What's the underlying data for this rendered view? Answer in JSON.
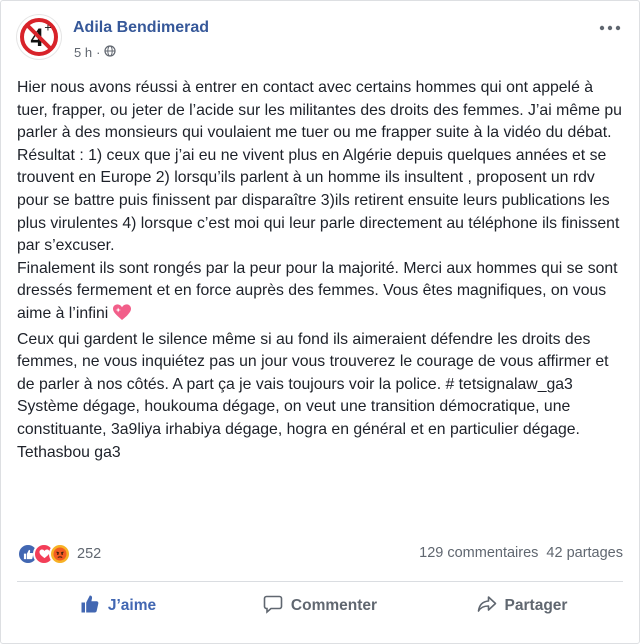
{
  "post": {
    "author": "Adila Bendimerad",
    "timestamp": "5 h",
    "separator": "·",
    "privacy_icon": "globe-icon",
    "paragraphs": [
      "Hier nous avons réussi à entrer en contact avec certains hommes qui ont appelé à tuer, frapper, ou jeter de l’acide sur les militantes des droits des femmes. J’ai même pu parler à des monsieurs qui voulaient me tuer ou me frapper suite à la vidéo du débat. Résultat : 1) ceux que j’ai eu ne vivent plus en Algérie depuis quelques années et se trouvent en Europe 2) lorsqu’ils parlent à un homme ils insultent , proposent un rdv pour se battre puis finissent par disparaître 3)ils retirent ensuite leurs publications les plus virulentes 4) lorsque c’est moi qui leur parle directement au téléphone ils finissent par s’excuser.",
      "Finalement ils sont rongés par la peur pour la majorité. Merci aux hommes qui se sont dressés fermement et en force auprès des femmes. Vous êtes magnifiques, on vous aime à l’infini",
      "Ceux qui gardent le silence même si au fond ils aimeraient défendre les droits des femmes, ne vous inquiétez pas un jour vous trouverez le courage de vous affirmer et de parler à nos côtés. A part ça je vais toujours voir la police. # tetsignalaw_ga3",
      "Système dégage, houkouma dégage, on veut une transition démocratique, une constituante, 3a9liya irhabiya dégage, hogra en général et en particulier dégage. Tethasbou ga3"
    ],
    "avatar_text": "4",
    "avatar_superscript": "+"
  },
  "stats": {
    "reaction_count": "252",
    "reaction_icons": [
      "like-icon",
      "love-icon",
      "angry-icon"
    ],
    "comments": "129 commentaires",
    "shares": "42 partages"
  },
  "actions": {
    "like": "J’aime",
    "comment": "Commenter",
    "share": "Partager"
  },
  "colors": {
    "link_blue": "#365899",
    "like_blue": "#4267b2",
    "love_red": "#f33e58",
    "angry_orange": "#f7b125",
    "text": "#1d2129",
    "secondary": "#606770"
  }
}
